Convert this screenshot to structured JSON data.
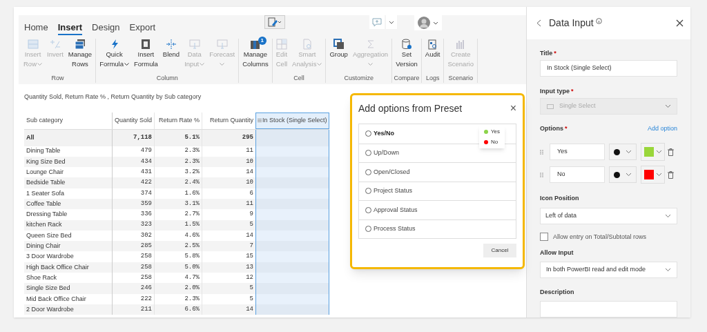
{
  "menu_tabs": [
    {
      "label": "Home",
      "selected": false
    },
    {
      "label": "Insert",
      "selected": true
    },
    {
      "label": "Design",
      "selected": false
    },
    {
      "label": "Export",
      "selected": false
    }
  ],
  "ribbon": [
    {
      "group": "Row",
      "items": [
        {
          "lines": [
            "Insert",
            "Row"
          ],
          "dropdown": true,
          "disabled": true
        },
        {
          "lines": [
            "Invert"
          ],
          "dropdown": false,
          "disabled": true
        },
        {
          "lines": [
            "Manage",
            "Rows"
          ],
          "dropdown": false,
          "disabled": false
        }
      ]
    },
    {
      "group": "Column",
      "items": [
        {
          "lines": [
            "Quick",
            "Formula"
          ],
          "dropdown": true,
          "disabled": false
        },
        {
          "lines": [
            "Insert",
            "Formula"
          ],
          "dropdown": false,
          "disabled": false
        },
        {
          "lines": [
            "Blend"
          ],
          "dropdown": false,
          "disabled": false
        },
        {
          "lines": [
            "Data",
            "Input"
          ],
          "dropdown": true,
          "disabled": true
        },
        {
          "lines": [
            "Forecast"
          ],
          "dropdown": true,
          "disabled": true
        }
      ]
    },
    {
      "items": [
        {
          "lines": [
            "Manage",
            "Columns"
          ],
          "dropdown": false,
          "disabled": false,
          "badge": "1"
        }
      ]
    },
    {
      "group": "Cell",
      "items": [
        {
          "lines": [
            "Edit",
            "Cell"
          ],
          "dropdown": false,
          "disabled": true
        },
        {
          "lines": [
            "Smart",
            "Analysis"
          ],
          "dropdown": true,
          "disabled": true
        }
      ]
    },
    {
      "group": "Customize",
      "items": [
        {
          "lines": [
            "Group"
          ],
          "dropdown": false,
          "disabled": false
        },
        {
          "lines": [
            "Aggregation"
          ],
          "dropdown": true,
          "disabled": true
        }
      ]
    },
    {
      "group": "Compare",
      "items": [
        {
          "lines": [
            "Set",
            "Version"
          ],
          "dropdown": false,
          "disabled": false
        }
      ]
    },
    {
      "group": "Logs",
      "items": [
        {
          "lines": [
            "Audit"
          ],
          "dropdown": false,
          "disabled": false
        }
      ]
    },
    {
      "group": "Scenario",
      "items": [
        {
          "lines": [
            "Create",
            "Scenario"
          ],
          "dropdown": false,
          "disabled": true
        }
      ]
    }
  ],
  "visual_title": "Quantity Sold, Return Rate % , Return Quantity by Sub category",
  "table": {
    "columns": [
      "Sub category",
      "Quantity Sold",
      "Return Rate %",
      "Return Quantity",
      "In Stock (Single Select)"
    ],
    "total": [
      "All",
      "7,118",
      "5.1%",
      "295"
    ],
    "rows": [
      [
        "Dining Table",
        "479",
        "2.3%",
        "11"
      ],
      [
        "King Size Bed",
        "434",
        "2.3%",
        "10"
      ],
      [
        "Lounge Chair",
        "431",
        "3.2%",
        "14"
      ],
      [
        "Bedside Table",
        "422",
        "2.4%",
        "10"
      ],
      [
        "1 Seater Sofa",
        "374",
        "1.6%",
        "6"
      ],
      [
        "Coffee Table",
        "359",
        "3.1%",
        "11"
      ],
      [
        "Dressing Table",
        "336",
        "2.7%",
        "9"
      ],
      [
        "kitchen Rack",
        "323",
        "1.5%",
        "5"
      ],
      [
        "Queen Size Bed",
        "302",
        "4.6%",
        "14"
      ],
      [
        "Dining Chair",
        "285",
        "2.5%",
        "7"
      ],
      [
        "3 Door Wardrobe",
        "258",
        "5.8%",
        "15"
      ],
      [
        "High Back Office Chair",
        "258",
        "5.0%",
        "13"
      ],
      [
        "Shoe Rack",
        "258",
        "4.7%",
        "12"
      ],
      [
        "Single Size Bed",
        "246",
        "2.0%",
        "5"
      ],
      [
        "Mid Back Office Chair",
        "222",
        "2.3%",
        "5"
      ],
      [
        "2 Door Wardrobe",
        "211",
        "6.6%",
        "14"
      ]
    ]
  },
  "dialog": {
    "title": "Add options from Preset",
    "close": "×",
    "presets": [
      {
        "label": "Yes/No",
        "selected": false,
        "hovered": true
      },
      {
        "label": "Up/Down",
        "selected": false,
        "hovered": false
      },
      {
        "label": "Open/Closed",
        "selected": false,
        "hovered": false
      },
      {
        "label": "Project Status",
        "selected": false,
        "hovered": false
      },
      {
        "label": "Approval Status",
        "selected": false,
        "hovered": false
      },
      {
        "label": "Process Status",
        "selected": false,
        "hovered": false
      }
    ],
    "preview": [
      {
        "label": "Yes",
        "color": "#8cd44a"
      },
      {
        "label": "No",
        "color": "#ff0000"
      }
    ],
    "cancel": "Cancel"
  },
  "panel": {
    "title": "Data Input",
    "fields": {
      "title_label": "Title",
      "title_required": "*",
      "type_required": "*",
      "options_required": "*",
      "title_value": "In Stock (Single Select)",
      "type_label": "Input type",
      "type_value": "Single Select",
      "options_label": "Options",
      "add_option": "Add option"
    },
    "options": [
      {
        "label": "Yes",
        "color": "#99d63a"
      },
      {
        "label": "No",
        "color": "#ff0000"
      }
    ],
    "icon_position_label": "Icon Position",
    "icon_position": "Left of data",
    "allow_total": {
      "label": "Allow entry on Total/Subtotal rows",
      "checked": false
    },
    "allow_input_label": "Allow Input",
    "allow_input": "In both PowerBI read and edit mode",
    "description_label": "Description"
  }
}
